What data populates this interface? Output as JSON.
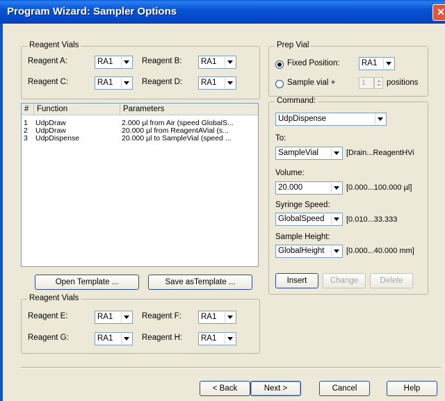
{
  "window": {
    "title": "Program Wizard: Sampler Options",
    "close_glyph": "✕"
  },
  "reagent_vials_top": {
    "title": "Reagent Vials",
    "reagent_a": {
      "label": "Reagent A:",
      "value": "RA1"
    },
    "reagent_b": {
      "label": "Reagent B:",
      "value": "RA1"
    },
    "reagent_c": {
      "label": "Reagent C:",
      "value": "RA1"
    },
    "reagent_d": {
      "label": "Reagent D:",
      "value": "RA1"
    }
  },
  "prep_vial": {
    "title": "Prep Vial",
    "fixed_position": {
      "label": "Fixed Position:",
      "selected": true,
      "value": "RA1"
    },
    "sample_vial_plus": {
      "label": "Sample vial +",
      "selected": false,
      "value": "1",
      "suffix": "positions"
    }
  },
  "function_list": {
    "columns": [
      "#",
      "Function",
      "Parameters"
    ],
    "rows": [
      {
        "num": "1",
        "function": "UdpDraw",
        "parameters": "2.000  µl from Air (speed GlobalS..."
      },
      {
        "num": "2",
        "function": "UdpDraw",
        "parameters": "20.000  µl from ReagentAVial (s..."
      },
      {
        "num": "3",
        "function": "UdpDispense",
        "parameters": "20.000  µl to SampleVial (speed ..."
      }
    ]
  },
  "template_buttons": {
    "open": "Open Template ...",
    "save": "Save asTemplate ..."
  },
  "command": {
    "title": "Command:",
    "value": "UdpDispense",
    "to": {
      "label": "To:",
      "value": "SampleVial",
      "range": "[Drain...ReagentHVi"
    },
    "volume": {
      "label": "Volume:",
      "value": "20.000",
      "range": "[0.000...100.000 µl]"
    },
    "syringe_speed": {
      "label": "Syringe Speed:",
      "value": "GlobalSpeed",
      "range": "[0.010...33.333"
    },
    "sample_height": {
      "label": "Sample Height:",
      "value": "GlobalHeight",
      "range": "[0.000...40.000 mm]"
    },
    "buttons": {
      "insert": "Insert",
      "change": "Change",
      "delete": "Delete"
    }
  },
  "reagent_vials_bottom": {
    "title": "Reagent Vials",
    "reagent_e": {
      "label": "Reagent E:",
      "value": "RA1"
    },
    "reagent_f": {
      "label": "Reagent F:",
      "value": "RA1"
    },
    "reagent_g": {
      "label": "Reagent G:",
      "value": "RA1"
    },
    "reagent_h": {
      "label": "Reagent H:",
      "value": "RA1"
    }
  },
  "footer": {
    "back": "< Back",
    "next": "Next >",
    "cancel": "Cancel",
    "help": "Help"
  }
}
